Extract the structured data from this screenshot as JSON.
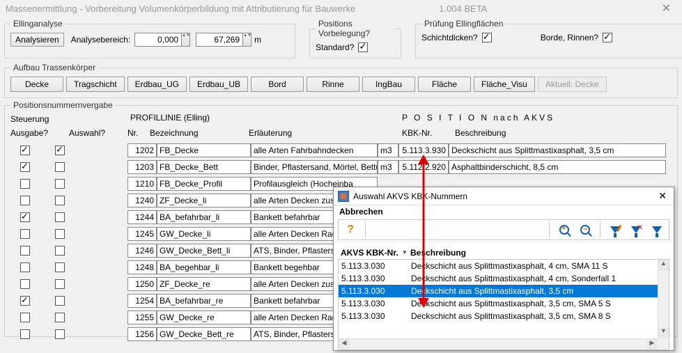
{
  "window": {
    "title": "Massenermittlung - Vorbereitung Volumenkörperbildung mit Attributierung für Bauwerke",
    "version": "1.004 BETA"
  },
  "elling": {
    "legend": "Ellinganalyse",
    "analyse_btn": "Analysieren",
    "bereich_label": "Analysebereich:",
    "from": "0,000",
    "to": "67,269",
    "unit": "m"
  },
  "posvor": {
    "legend": "Positions Vorbelegung?",
    "standard_label": "Standard?",
    "standard_checked": true
  },
  "pruef": {
    "legend": "Prüfung Ellingflächen",
    "schicht_label": "Schichtdicken?",
    "schicht_checked": true,
    "borde_label": "Borde, Rinnen?",
    "borde_checked": true
  },
  "trasse": {
    "legend": "Aufbau Trassenkörper",
    "buttons": [
      "Decke",
      "Tragschicht",
      "Erdbau_UG",
      "Erdbau_UB",
      "Bord",
      "Rinne",
      "IngBau",
      "Fläche",
      "Fläche_Visu"
    ],
    "disabled": "Aktuell: Decke"
  },
  "posnum": {
    "legend": "Positionsnummernvergabe",
    "steuerung": "Steuerung",
    "profillinie": "PROFILLINIE (Elling)",
    "akvs": "P O S I T I O N  nach AKVS",
    "ausgabe": "Ausgabe?",
    "auswahl": "Auswahl?",
    "col_nr": "Nr.",
    "col_bez": "Bezeichnung",
    "col_erl": "Erläuterung",
    "col_kbk": "KBK-Nr.",
    "col_besch": "Beschreibung",
    "rows": [
      {
        "out": true,
        "sel": true,
        "nr": "1202",
        "bez": "FB_Decke",
        "erl": "alle Arten Fahrbahndecken",
        "unit": "m3",
        "kbk": "5.113.3.930",
        "besch": "Deckschicht aus Splittmastixasphalt, 3,5 cm"
      },
      {
        "out": true,
        "sel": false,
        "nr": "1203",
        "bez": "FB_Decke_Bett",
        "erl": "Binder, Pflastersand, Mörtel, Bettung",
        "unit": "m3",
        "kbk": "5.112.2.920",
        "besch": "Asphaltbinderschicht, 8,5 cm"
      },
      {
        "out": false,
        "sel": false,
        "nr": "1210",
        "bez": "FB_Decke_Profil",
        "erl": "Profilausgleich (Hocheinba",
        "unit": "",
        "kbk": "",
        "besch": ""
      },
      {
        "out": false,
        "sel": false,
        "nr": "1240",
        "bez": "ZF_Decke_li",
        "erl": "alle Arten Decken zus. Fa",
        "unit": "",
        "kbk": "",
        "besch": ""
      },
      {
        "out": true,
        "sel": false,
        "nr": "1244",
        "bez": "BA_befahrbar_li",
        "erl": "Bankett befahrbar",
        "unit": "",
        "kbk": "",
        "besch": ""
      },
      {
        "out": false,
        "sel": false,
        "nr": "1245",
        "bez": "GW_Decke_li",
        "erl": "alle Arten Decken Rad-/G",
        "unit": "",
        "kbk": "",
        "besch": ""
      },
      {
        "out": false,
        "sel": false,
        "nr": "1246",
        "bez": "GW_Decke_Bett_li",
        "erl": "ATS, Binder, Pflastersand",
        "unit": "",
        "kbk": "",
        "besch": ""
      },
      {
        "out": false,
        "sel": false,
        "nr": "1248",
        "bez": "BA_begehbar_li",
        "erl": "Bankett begehbar",
        "unit": "",
        "kbk": "",
        "besch": ""
      },
      {
        "out": false,
        "sel": false,
        "nr": "1250",
        "bez": "ZF_Decke_re",
        "erl": "alle Arten Decken zus. Fa",
        "unit": "",
        "kbk": "",
        "besch": ""
      },
      {
        "out": true,
        "sel": false,
        "nr": "1254",
        "bez": "BA_befahrbar_re",
        "erl": "Bankett befahrbar",
        "unit": "",
        "kbk": "",
        "besch": ""
      },
      {
        "out": false,
        "sel": false,
        "nr": "1255",
        "bez": "GW_Decke_re",
        "erl": "alle Arten Decken Rad-/G",
        "unit": "",
        "kbk": "",
        "besch": ""
      },
      {
        "out": false,
        "sel": false,
        "nr": "1256",
        "bez": "GW_Decke_Bett_re",
        "erl": "ATS, Binder, Pflastersand",
        "unit": "",
        "kbk": "",
        "besch": ""
      }
    ]
  },
  "dialog": {
    "title": "Auswahl AKVS KBK-Nummern",
    "abbrechen": "Abbrechen",
    "col_kbk": "AKVS KBK-Nr.",
    "col_besch": "Beschreibung",
    "rows": [
      {
        "k": "5.113.3.030",
        "b": "Deckschicht aus Splittmastixasphalt, 4 cm, SMA 11 S",
        "sel": false
      },
      {
        "k": "5.113.3.030",
        "b": "Deckschicht aus Splittmastixasphalt, 4 cm, Sonderfall 1",
        "sel": false
      },
      {
        "k": "5.113.3.030",
        "b": "Deckschicht aus Splittmastixasphalt, 3,5 cm",
        "sel": true
      },
      {
        "k": "5.113.3.030",
        "b": "Deckschicht aus Splittmastixasphalt, 3,5 cm, SMA 5 S",
        "sel": false
      },
      {
        "k": "5.113.3.030",
        "b": "Deckschicht aus Splittmastixasphalt, 3,5 cm, SMA 8 S",
        "sel": false
      }
    ]
  }
}
